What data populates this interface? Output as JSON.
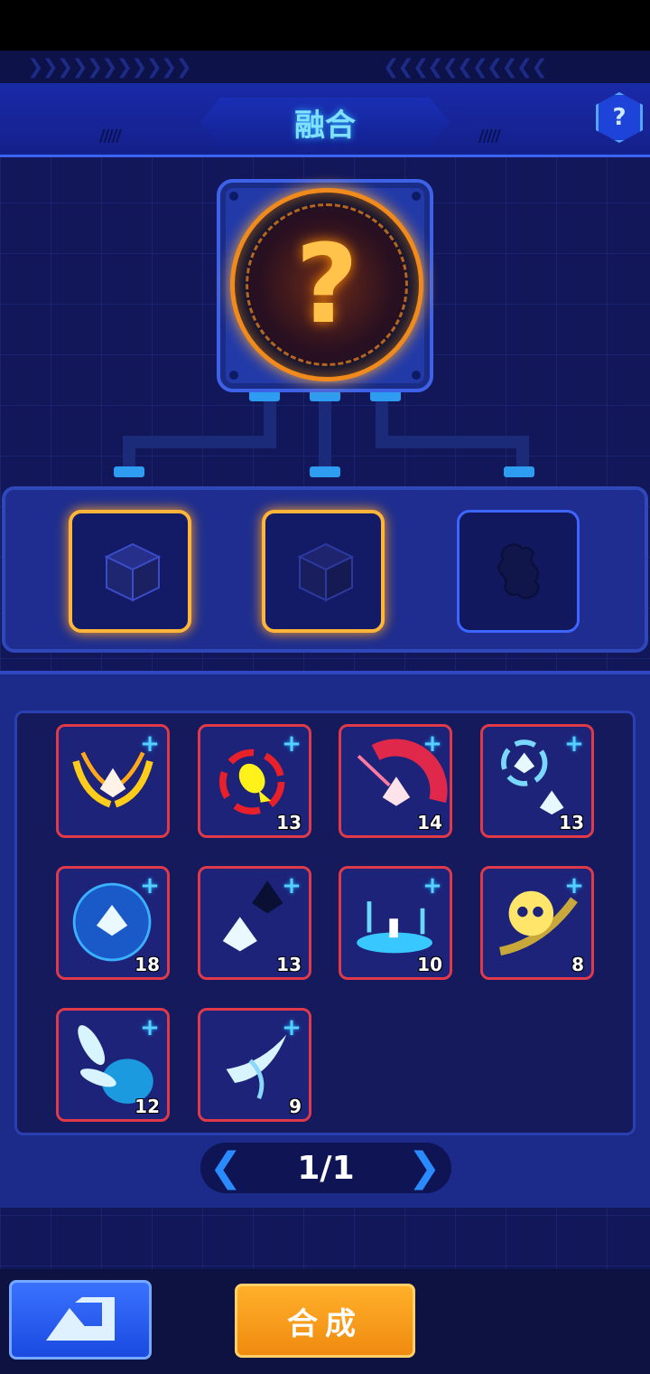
{
  "header": {
    "title": "融合",
    "help_icon": "question-mark-icon",
    "help_glyph": "?"
  },
  "fusion_result": {
    "state": "unknown",
    "glyph": "?"
  },
  "slots": [
    {
      "state": "filled",
      "icon": "cube-icon"
    },
    {
      "state": "filled",
      "icon": "cube-icon"
    },
    {
      "state": "locked",
      "icon": "puzzle-silhouette-icon"
    }
  ],
  "skills": [
    {
      "icon": "golden-wings-ship-icon",
      "level": ""
    },
    {
      "icon": "yellow-missile-target-icon",
      "level": "13"
    },
    {
      "icon": "red-slash-ship-icon",
      "level": "14"
    },
    {
      "icon": "blue-swirl-ship-icon",
      "level": "13"
    },
    {
      "icon": "blue-shield-ship-icon",
      "level": "18"
    },
    {
      "icon": "twin-ship-icon",
      "level": "13"
    },
    {
      "icon": "blue-portal-icon",
      "level": "10"
    },
    {
      "icon": "skull-comet-icon",
      "level": "8"
    },
    {
      "icon": "ice-shards-icon",
      "level": "12"
    },
    {
      "icon": "crescent-blade-icon",
      "level": "9"
    }
  ],
  "skill_badge_glyph": "+",
  "pager": {
    "page": "1/1",
    "prev_glyph": "❮",
    "next_glyph": "❯"
  },
  "footer": {
    "back_icon": "back-arrow-icon",
    "compose_label": "合成"
  },
  "colors": {
    "accent_orange": "#f08a1c",
    "slot_highlight": "#ffb43a",
    "card_border": "#e03a4a",
    "plus_badge": "#58d0ff",
    "panel_blue": "#1c2a8a"
  }
}
